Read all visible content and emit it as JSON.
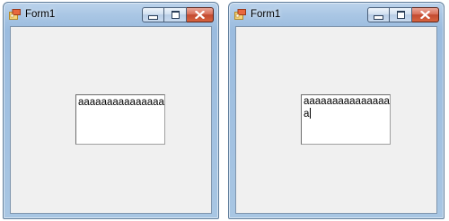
{
  "windows": [
    {
      "title": "Form1",
      "textbox": {
        "lines": [
          "aaaaaaaaaaaaaaaa"
        ]
      }
    },
    {
      "title": "Form1",
      "textbox": {
        "lines": [
          "aaaaaaaaaaaaaaaa",
          "a"
        ]
      }
    }
  ],
  "icons": {
    "app": "winforms-app-icon",
    "minimize": "minimize-icon",
    "maximize": "maximize-icon",
    "close": "close-icon"
  },
  "colors": {
    "client_background": "#f0f0f0",
    "close_button": "#c24a31",
    "frame": "#a9c6e4"
  }
}
